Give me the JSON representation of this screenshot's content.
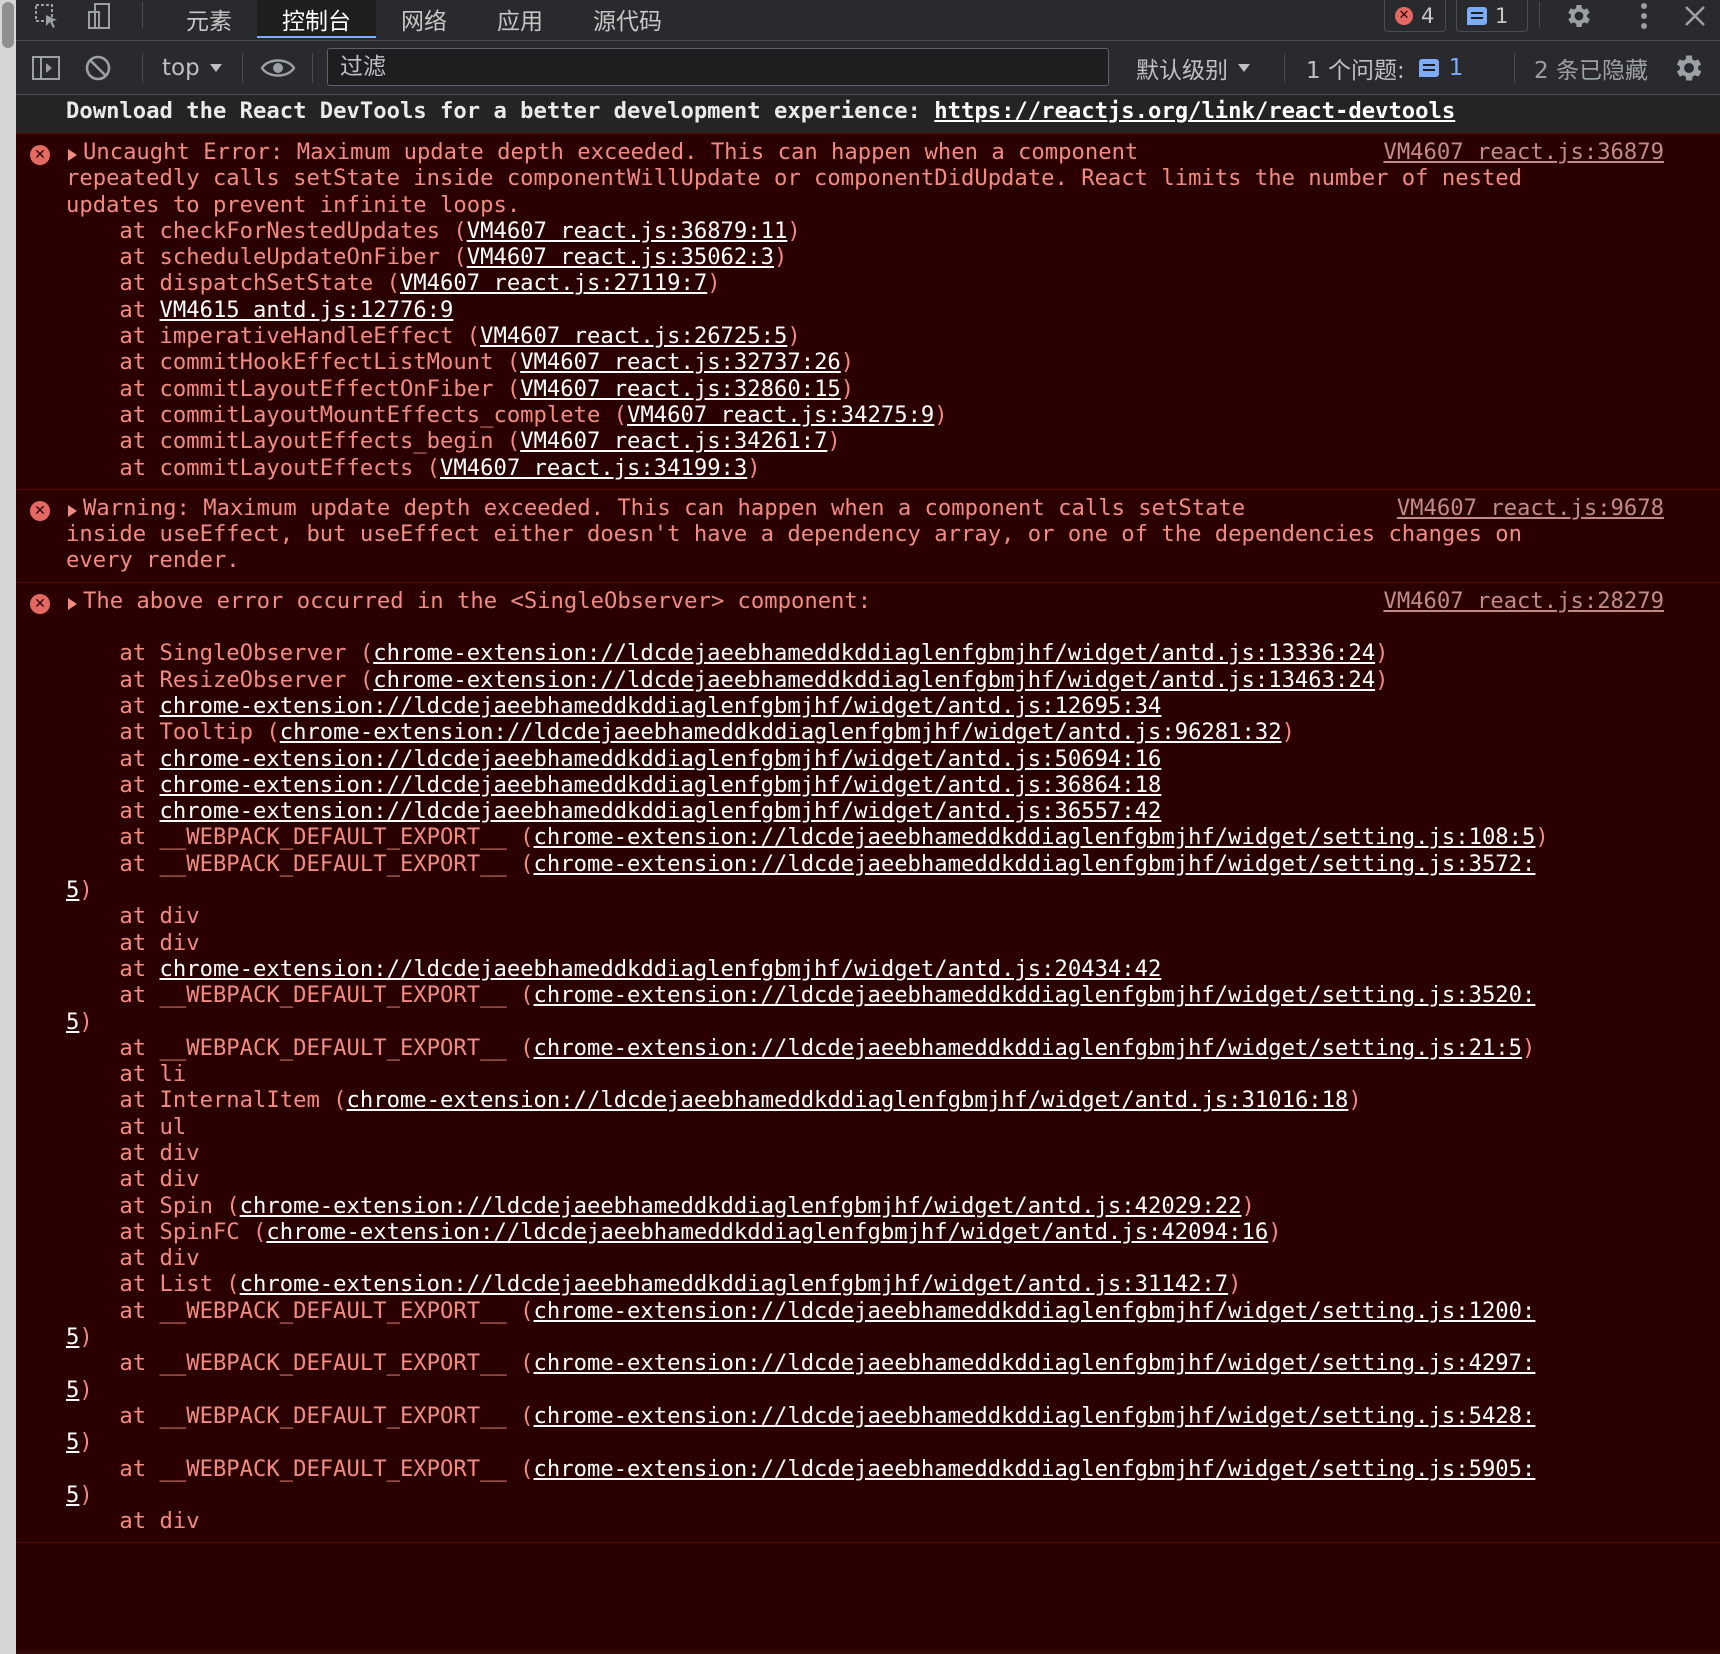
{
  "tabs": [
    "元素",
    "控制台",
    "网络",
    "应用",
    "源代码"
  ],
  "active_tab": "控制台",
  "badges": {
    "errors": "4",
    "messages": "1"
  },
  "toolbar": {
    "context": "top",
    "filter_placeholder": "过滤",
    "level": "默认级别",
    "issues_label": "1 个问题:",
    "issues_count": "1",
    "hidden": "2 条已隐藏"
  },
  "icons": [
    "inspect-icon",
    "device-icon",
    "error-icon",
    "message-icon",
    "gear-icon",
    "more-icon",
    "close-icon",
    "sidebar-icon",
    "clear-icon",
    "eye-icon"
  ],
  "colors": {
    "error_bg": "#2a0000",
    "error_text": "#f28b82",
    "toolbar_bg": "#292a2d",
    "accent": "#7cacf8"
  },
  "console": {
    "devtools_msg": {
      "text": "Download the React DevTools for a better development experience: ",
      "link": "https://reactjs.org/link/react-devtools"
    },
    "entries": [
      {
        "source": "VM4607 react.js:36879",
        "lines": [
          [
            {
              "t": "Uncaught Error: Maximum update depth exceeded. This can happen when a component"
            }
          ],
          [
            {
              "t": "repeatedly calls setState inside componentWillUpdate or componentDidUpdate. React limits the number of nested"
            }
          ],
          [
            {
              "t": "updates to prevent infinite loops."
            }
          ],
          [
            {
              "t": "    at checkForNestedUpdates ("
            },
            {
              "l": "VM4607 react.js:36879:11"
            },
            {
              "t": ")"
            }
          ],
          [
            {
              "t": "    at scheduleUpdateOnFiber ("
            },
            {
              "l": "VM4607 react.js:35062:3"
            },
            {
              "t": ")"
            }
          ],
          [
            {
              "t": "    at dispatchSetState ("
            },
            {
              "l": "VM4607 react.js:27119:7"
            },
            {
              "t": ")"
            }
          ],
          [
            {
              "t": "    at "
            },
            {
              "l": "VM4615 antd.js:12776:9"
            }
          ],
          [
            {
              "t": "    at imperativeHandleEffect ("
            },
            {
              "l": "VM4607 react.js:26725:5"
            },
            {
              "t": ")"
            }
          ],
          [
            {
              "t": "    at commitHookEffectListMount ("
            },
            {
              "l": "VM4607 react.js:32737:26"
            },
            {
              "t": ")"
            }
          ],
          [
            {
              "t": "    at commitLayoutEffectOnFiber ("
            },
            {
              "l": "VM4607 react.js:32860:15"
            },
            {
              "t": ")"
            }
          ],
          [
            {
              "t": "    at commitLayoutMountEffects_complete ("
            },
            {
              "l": "VM4607 react.js:34275:9"
            },
            {
              "t": ")"
            }
          ],
          [
            {
              "t": "    at commitLayoutEffects_begin ("
            },
            {
              "l": "VM4607 react.js:34261:7"
            },
            {
              "t": ")"
            }
          ],
          [
            {
              "t": "    at commitLayoutEffects ("
            },
            {
              "l": "VM4607 react.js:34199:3"
            },
            {
              "t": ")"
            }
          ]
        ]
      },
      {
        "source": "VM4607 react.js:9678",
        "lines": [
          [
            {
              "t": "Warning: Maximum update depth exceeded. This can happen when a component calls setState"
            }
          ],
          [
            {
              "t": "inside useEffect, but useEffect either doesn't have a dependency array, or one of the dependencies changes on"
            }
          ],
          [
            {
              "t": "every render."
            }
          ]
        ]
      },
      {
        "source": "VM4607 react.js:28279",
        "lines": [
          [
            {
              "t": "The above error occurred in the <SingleObserver> component:"
            }
          ],
          [
            {
              "t": ""
            }
          ],
          [
            {
              "t": "    at SingleObserver ("
            },
            {
              "l": "chrome-extension://ldcdejaeebhameddkddiaglenfgbmjhf/widget/antd.js:13336:24"
            },
            {
              "t": ")"
            }
          ],
          [
            {
              "t": "    at ResizeObserver ("
            },
            {
              "l": "chrome-extension://ldcdejaeebhameddkddiaglenfgbmjhf/widget/antd.js:13463:24"
            },
            {
              "t": ")"
            }
          ],
          [
            {
              "t": "    at "
            },
            {
              "l": "chrome-extension://ldcdejaeebhameddkddiaglenfgbmjhf/widget/antd.js:12695:34"
            }
          ],
          [
            {
              "t": "    at Tooltip ("
            },
            {
              "l": "chrome-extension://ldcdejaeebhameddkddiaglenfgbmjhf/widget/antd.js:96281:32"
            },
            {
              "t": ")"
            }
          ],
          [
            {
              "t": "    at "
            },
            {
              "l": "chrome-extension://ldcdejaeebhameddkddiaglenfgbmjhf/widget/antd.js:50694:16"
            }
          ],
          [
            {
              "t": "    at "
            },
            {
              "l": "chrome-extension://ldcdejaeebhameddkddiaglenfgbmjhf/widget/antd.js:36864:18"
            }
          ],
          [
            {
              "t": "    at "
            },
            {
              "l": "chrome-extension://ldcdejaeebhameddkddiaglenfgbmjhf/widget/antd.js:36557:42"
            }
          ],
          [
            {
              "t": "    at __WEBPACK_DEFAULT_EXPORT__ ("
            },
            {
              "l": "chrome-extension://ldcdejaeebhameddkddiaglenfgbmjhf/widget/setting.js:108:5"
            },
            {
              "t": ")"
            }
          ],
          [
            {
              "t": "    at __WEBPACK_DEFAULT_EXPORT__ ("
            },
            {
              "l": "chrome-extension://ldcdejaeebhameddkddiaglenfgbmjhf/widget/setting.js:3572:"
            }
          ],
          [
            {
              "l": "5"
            },
            {
              "t": ")"
            }
          ],
          [
            {
              "t": "    at div"
            }
          ],
          [
            {
              "t": "    at div"
            }
          ],
          [
            {
              "t": "    at "
            },
            {
              "l": "chrome-extension://ldcdejaeebhameddkddiaglenfgbmjhf/widget/antd.js:20434:42"
            }
          ],
          [
            {
              "t": "    at __WEBPACK_DEFAULT_EXPORT__ ("
            },
            {
              "l": "chrome-extension://ldcdejaeebhameddkddiaglenfgbmjhf/widget/setting.js:3520:"
            }
          ],
          [
            {
              "l": "5"
            },
            {
              "t": ")"
            }
          ],
          [
            {
              "t": "    at __WEBPACK_DEFAULT_EXPORT__ ("
            },
            {
              "l": "chrome-extension://ldcdejaeebhameddkddiaglenfgbmjhf/widget/setting.js:21:5"
            },
            {
              "t": ")"
            }
          ],
          [
            {
              "t": "    at li"
            }
          ],
          [
            {
              "t": "    at InternalItem ("
            },
            {
              "l": "chrome-extension://ldcdejaeebhameddkddiaglenfgbmjhf/widget/antd.js:31016:18"
            },
            {
              "t": ")"
            }
          ],
          [
            {
              "t": "    at ul"
            }
          ],
          [
            {
              "t": "    at div"
            }
          ],
          [
            {
              "t": "    at div"
            }
          ],
          [
            {
              "t": "    at Spin ("
            },
            {
              "l": "chrome-extension://ldcdejaeebhameddkddiaglenfgbmjhf/widget/antd.js:42029:22"
            },
            {
              "t": ")"
            }
          ],
          [
            {
              "t": "    at SpinFC ("
            },
            {
              "l": "chrome-extension://ldcdejaeebhameddkddiaglenfgbmjhf/widget/antd.js:42094:16"
            },
            {
              "t": ")"
            }
          ],
          [
            {
              "t": "    at div"
            }
          ],
          [
            {
              "t": "    at List ("
            },
            {
              "l": "chrome-extension://ldcdejaeebhameddkddiaglenfgbmjhf/widget/antd.js:31142:7"
            },
            {
              "t": ")"
            }
          ],
          [
            {
              "t": "    at __WEBPACK_DEFAULT_EXPORT__ ("
            },
            {
              "l": "chrome-extension://ldcdejaeebhameddkddiaglenfgbmjhf/widget/setting.js:1200:"
            }
          ],
          [
            {
              "l": "5"
            },
            {
              "t": ")"
            }
          ],
          [
            {
              "t": "    at __WEBPACK_DEFAULT_EXPORT__ ("
            },
            {
              "l": "chrome-extension://ldcdejaeebhameddkddiaglenfgbmjhf/widget/setting.js:4297:"
            }
          ],
          [
            {
              "l": "5"
            },
            {
              "t": ")"
            }
          ],
          [
            {
              "t": "    at __WEBPACK_DEFAULT_EXPORT__ ("
            },
            {
              "l": "chrome-extension://ldcdejaeebhameddkddiaglenfgbmjhf/widget/setting.js:5428:"
            }
          ],
          [
            {
              "l": "5"
            },
            {
              "t": ")"
            }
          ],
          [
            {
              "t": "    at __WEBPACK_DEFAULT_EXPORT__ ("
            },
            {
              "l": "chrome-extension://ldcdejaeebhameddkddiaglenfgbmjhf/widget/setting.js:5905:"
            }
          ],
          [
            {
              "l": "5"
            },
            {
              "t": ")"
            }
          ],
          [
            {
              "t": "    at div"
            }
          ]
        ]
      }
    ]
  }
}
